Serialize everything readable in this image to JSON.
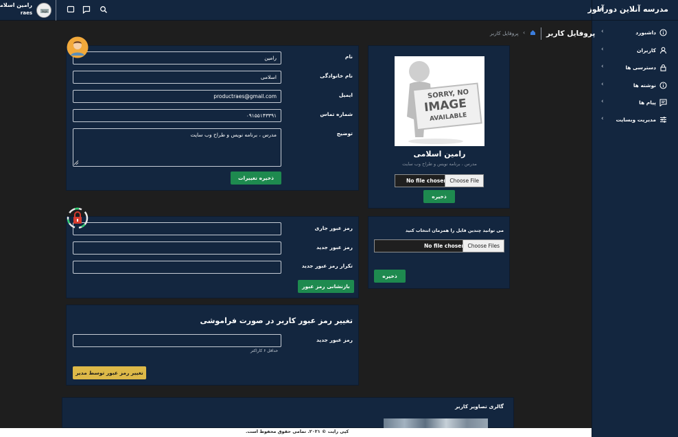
{
  "header": {
    "user_name": "رامین اسلامی",
    "user_sub": "raes"
  },
  "sidebar": {
    "brand": "مدرسه آنلاین دورآموز",
    "brand_icon": "collapse-icon",
    "items": [
      {
        "label": "داشبورد",
        "icon": "info-icon"
      },
      {
        "label": "کاربران",
        "icon": "user-icon"
      },
      {
        "label": "دسترسی ها",
        "icon": "lock-icon"
      },
      {
        "label": "نوشته ها",
        "icon": "info-icon"
      },
      {
        "label": "پیام ها",
        "icon": "message-icon"
      },
      {
        "label": "مدیریت وبسایت",
        "icon": "sliders-icon"
      }
    ]
  },
  "breadcrumb": {
    "title": "پروفایل کاربر",
    "current": "پروفایل کاربر"
  },
  "profile_form": {
    "first_name_label": "نام",
    "first_name_value": "رامین",
    "last_name_label": "نام خانوادگی",
    "last_name_value": "اسلامی",
    "email_label": "ایمیل",
    "email_value": "productraes@gmail.com",
    "phone_label": "شماره تماس",
    "phone_value": "۰۹۱۵۵۱۴۳۳۹۱",
    "description_label": "توضیح",
    "description_value": "مدرس ، برنامه نویس و طراح وب سایت",
    "save_label": "ذخیره تغییرات"
  },
  "profile_card": {
    "image_text_line1": "SORRY, NO",
    "image_text_line2": "IMAGE",
    "image_text_line3": "AVAILABLE",
    "name": "رامین اسلامی",
    "subtitle": "مدرس ، برنامه نویس و طراح وب سایت",
    "choose_file": "Choose File",
    "no_file": "No file chosen",
    "save_label": "ذخیره"
  },
  "password_form": {
    "current_label": "رمز عبور جاری",
    "new_label": "رمز عبور جدید",
    "repeat_label": "تکرار رمز عبور جدید",
    "reset_label": "بازنشانی رمز عبور"
  },
  "multi_upload": {
    "note": "می توانید چندین فایل را همزمان انتخاب کنید",
    "choose_files": "Choose Files",
    "no_file": "No file chosen",
    "save_label": "ذخیره"
  },
  "forgot_form": {
    "title": "تغییر رمز عبور کاربر در صورت فراموشی",
    "new_label": "رمز عبور جدید",
    "hint": "حداقل ۶ کاراکتر",
    "button_label": "تغییر رمز عبور توسط مدیر"
  },
  "gallery": {
    "title": "گالری تصاویر کاربر"
  },
  "footer": {
    "text": "کپی رایت © ۲۰۲۱. تمامی حقوق محفوظ است."
  },
  "colors": {
    "panel": "#13263f",
    "green": "#1e8a4f",
    "yellow": "#ddb948"
  }
}
